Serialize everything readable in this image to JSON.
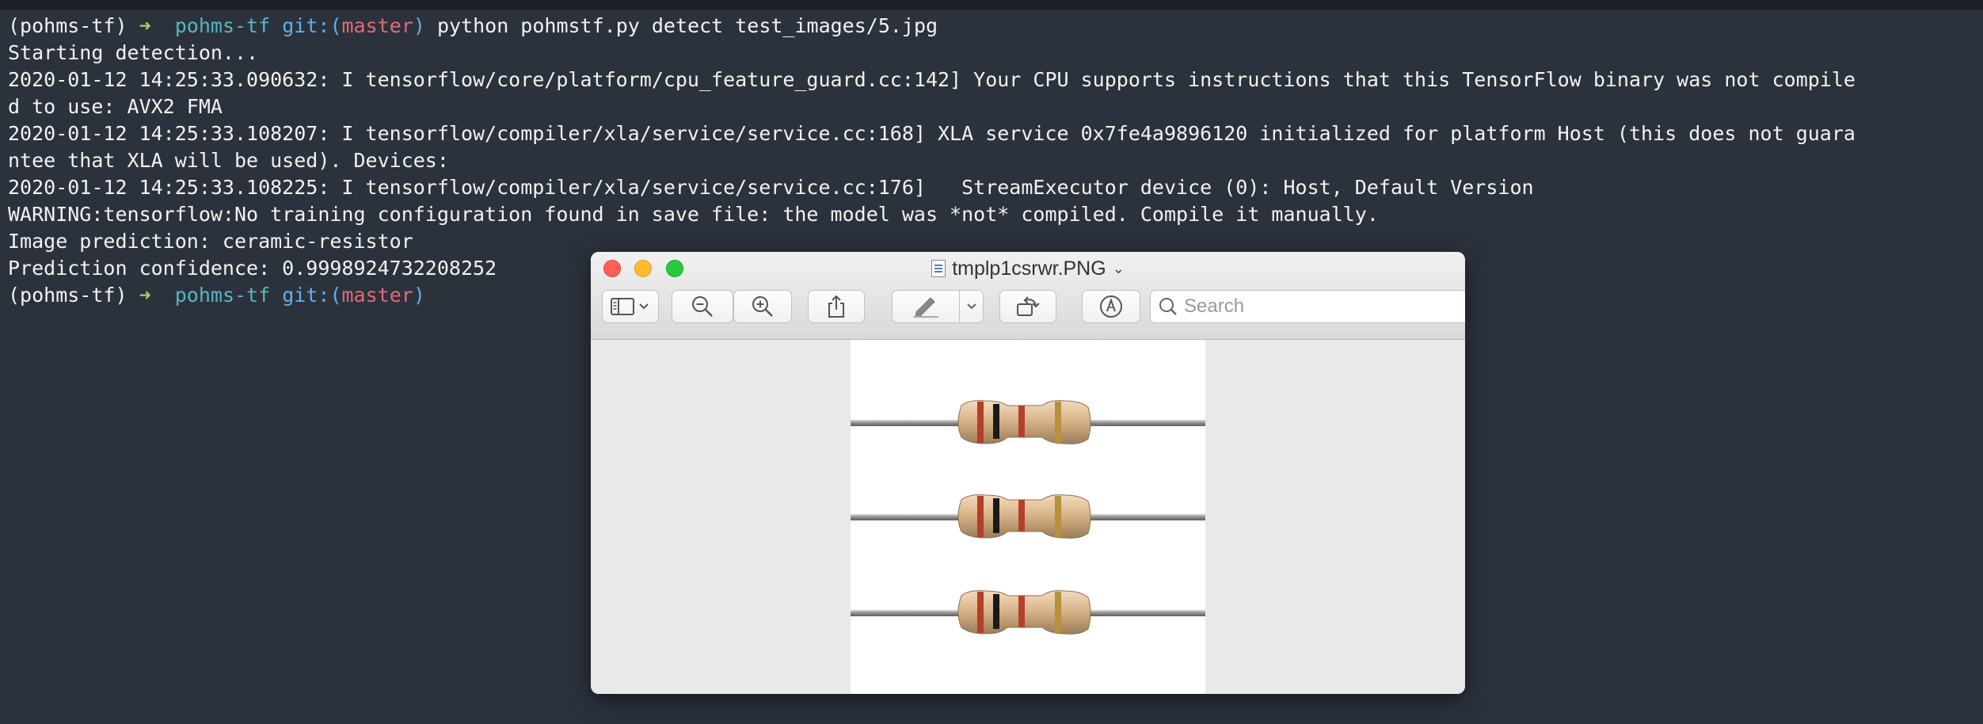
{
  "terminal": {
    "prompt_env": "(pohms-tf)",
    "prompt_arrow": "➜",
    "prompt_dir": "pohms-tf",
    "prompt_git": "git:(",
    "prompt_branch": "master",
    "prompt_git_close": ")",
    "command": "python pohmstf.py detect test_images/5.jpg",
    "lines": [
      "Starting detection...",
      "2020-01-12 14:25:33.090632: I tensorflow/core/platform/cpu_feature_guard.cc:142] Your CPU supports instructions that this TensorFlow binary was not compile",
      "d to use: AVX2 FMA",
      "2020-01-12 14:25:33.108207: I tensorflow/compiler/xla/service/service.cc:168] XLA service 0x7fe4a9896120 initialized for platform Host (this does not guara",
      "ntee that XLA will be used). Devices:",
      "2020-01-12 14:25:33.108225: I tensorflow/compiler/xla/service/service.cc:176]   StreamExecutor device (0): Host, Default Version",
      "WARNING:tensorflow:No training configuration found in save file: the model was *not* compiled. Compile it manually.",
      "Image prediction: ceramic-resistor",
      "Prediction confidence: 0.9998924732208252"
    ]
  },
  "preview": {
    "filename": "tmplp1csrwr.PNG",
    "title_chevron": "⌄",
    "search_placeholder": "Search",
    "markup_dropdown": "⌄"
  },
  "colors": {
    "terminal_bg": "#2c323c",
    "prompt_green": "#9bd36a",
    "prompt_cyan": "#56b6c2",
    "prompt_blue": "#61afef",
    "prompt_red": "#e06c75"
  }
}
